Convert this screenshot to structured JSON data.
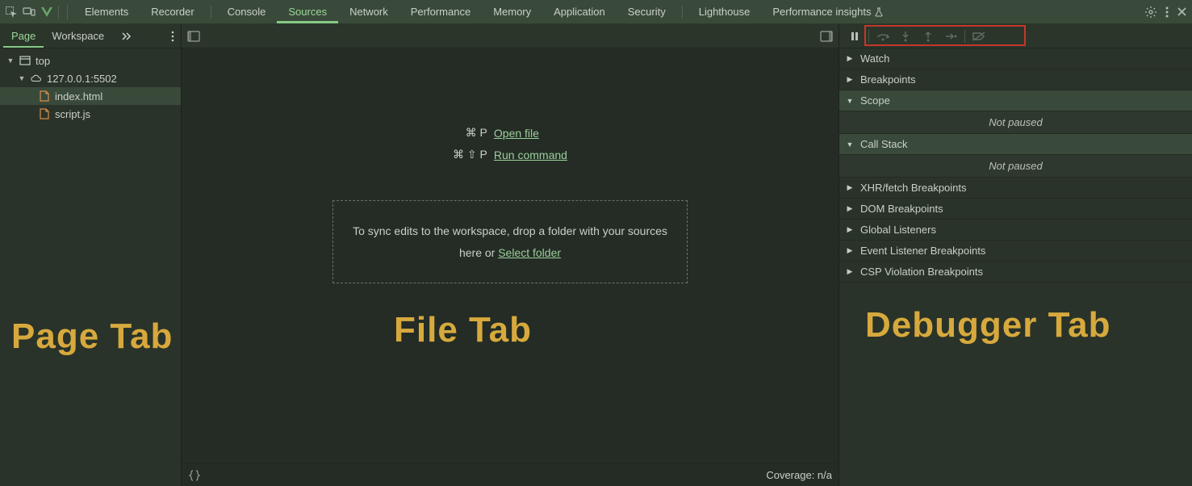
{
  "top_tabs": {
    "elements": "Elements",
    "recorder": "Recorder",
    "console": "Console",
    "sources": "Sources",
    "network": "Network",
    "performance": "Performance",
    "memory": "Memory",
    "application": "Application",
    "security": "Security",
    "lighthouse": "Lighthouse",
    "perf_insights": "Performance insights"
  },
  "navigator": {
    "tab_page": "Page",
    "tab_workspace": "Workspace",
    "top_label": "top",
    "origin_label": "127.0.0.1:5502",
    "file_index": "index.html",
    "file_script": "script.js"
  },
  "editor": {
    "open_file_shortcut": "⌘ P",
    "open_file_label": "Open file",
    "run_cmd_shortcut": "⌘ ⇧ P",
    "run_cmd_label": "Run command",
    "dropzone_text": "To sync edits to the workspace, drop a folder with your sources here or ",
    "dropzone_link": "Select folder",
    "coverage": "Coverage: n/a"
  },
  "debugger": {
    "sections": {
      "watch": "Watch",
      "breakpoints": "Breakpoints",
      "scope": "Scope",
      "callstack": "Call Stack",
      "xhr": "XHR/fetch Breakpoints",
      "dom": "DOM Breakpoints",
      "global": "Global Listeners",
      "event": "Event Listener Breakpoints",
      "csp": "CSP Violation Breakpoints"
    },
    "not_paused": "Not paused"
  },
  "annotations": {
    "page": "Page Tab",
    "file": "File Tab",
    "debugger": "Debugger Tab"
  }
}
